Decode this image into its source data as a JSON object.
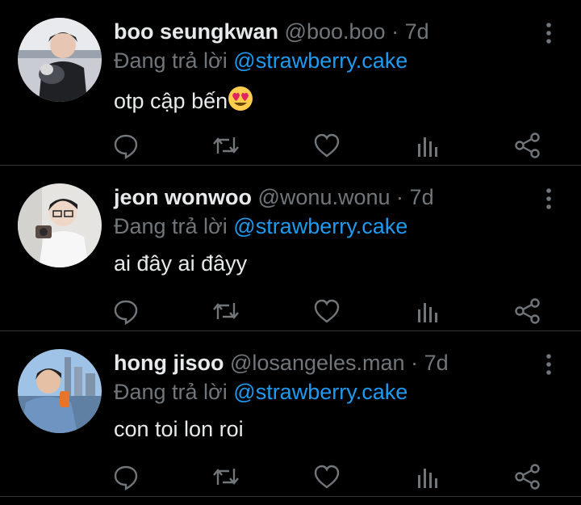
{
  "replies": [
    {
      "name": "boo seungkwan",
      "handle": "@boo.boo",
      "separator": "·",
      "time": "7d",
      "replying_prefix": "Đang trả lời",
      "replying_to": "@strawberry.cake",
      "content": "otp cập bến",
      "emoji": "heart-eyes-emoji"
    },
    {
      "name": "jeon wonwoo",
      "handle": "@wonu.wonu",
      "separator": "·",
      "time": "7d",
      "replying_prefix": "Đang trả lời",
      "replying_to": "@strawberry.cake",
      "content": "ai đây ai đâyy"
    },
    {
      "name": "hong jisoo",
      "handle": "@losangeles.man",
      "separator": "·",
      "time": "7d",
      "replying_prefix": "Đang trả lời",
      "replying_to": "@strawberry.cake",
      "content": "con toi lon roi"
    }
  ],
  "icons": {
    "reply": "reply-icon",
    "retweet": "retweet-icon",
    "like": "like-icon",
    "analytics": "analytics-icon",
    "share": "share-icon",
    "more": "more-vertical-icon"
  },
  "colors": {
    "background": "#000000",
    "text": "#e7e9ea",
    "secondary": "#71767b",
    "accent": "#1d9bf0",
    "divider": "#2f3336"
  }
}
